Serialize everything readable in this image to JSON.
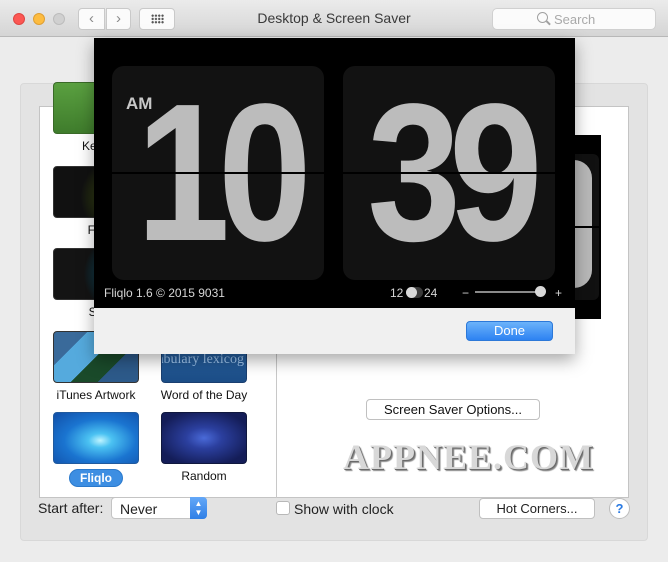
{
  "window": {
    "title": "Desktop & Screen Saver",
    "search_placeholder": "Search",
    "nav_back": "‹",
    "nav_forward": "›"
  },
  "screensavers": [
    {
      "label": "Ken Burns",
      "visible_label": "Ken I",
      "icon": "ken-burns-thumbnail"
    },
    {
      "label": "Flurry",
      "visible_label": "Flu",
      "icon": "flurry-thumbnail"
    },
    {
      "label": "Shell",
      "visible_label": "Sh",
      "icon": "shell-thumbnail"
    },
    {
      "label": "iTunes Artwork",
      "visible_label": "iTunes Artwork",
      "icon": "itunes-artwork-thumbnail"
    },
    {
      "label": "Word of the Day",
      "visible_label": "Word of the Day",
      "icon": "word-of-the-day-thumbnail",
      "thumb_text": "abulary lexicog"
    },
    {
      "label": "Fliqlo",
      "visible_label": "Fliqlo",
      "icon": "fliqlo-thumbnail",
      "selected": true
    },
    {
      "label": "Random",
      "visible_label": "Random",
      "icon": "random-thumbnail"
    }
  ],
  "options_button": "Screen Saver Options...",
  "watermark": "APPNEE.COM",
  "bottom": {
    "start_after_label": "Start after:",
    "start_after_value": "Never",
    "show_clock_label": "Show with clock",
    "show_clock_checked": false,
    "hot_corners_button": "Hot Corners...",
    "help": "?"
  },
  "fliqlo_sheet": {
    "ampm": "AM",
    "hours": "10",
    "minutes": "39",
    "version_text": "Fliqlo 1.6 © 2015 9031",
    "format_12": "12",
    "format_24": "24",
    "format_24h_enabled": false,
    "size_minus": "−",
    "size_plus": "+",
    "size_value": 0.93,
    "done_button": "Done"
  },
  "colors": {
    "accent": "#2d82f2",
    "selection": "#3d8ee2",
    "clock_digit": "#bcbcbc",
    "clock_card": "#121212"
  }
}
